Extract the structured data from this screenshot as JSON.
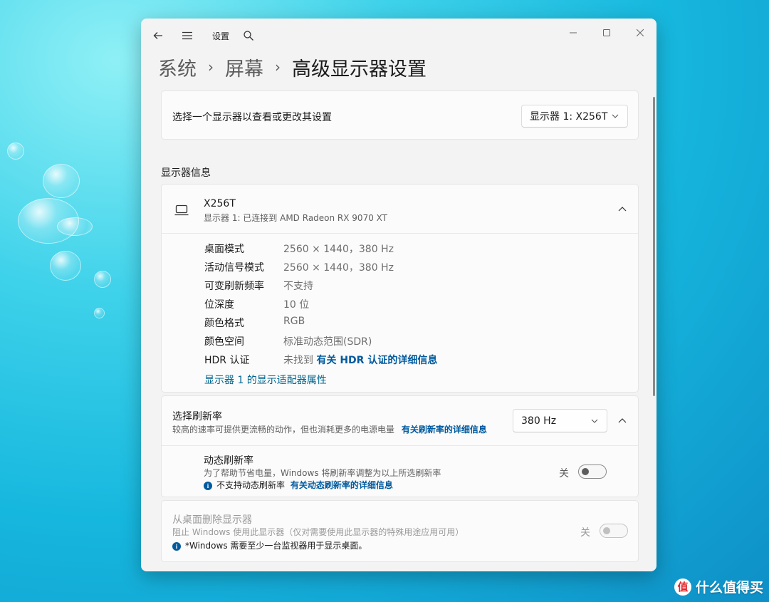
{
  "app": {
    "title": "设置"
  },
  "breadcrumb": {
    "items": [
      "系统",
      "屏幕"
    ],
    "current": "高级显示器设置"
  },
  "select_display": {
    "label": "选择一个显示器以查看或更改其设置",
    "value": "显示器 1: X256T"
  },
  "display_info": {
    "section_title": "显示器信息",
    "monitor_name": "X256T",
    "monitor_desc": "显示器 1: 已连接到 AMD Radeon RX 9070 XT",
    "rows": [
      {
        "label": "桌面模式",
        "value": "2560 × 1440，380 Hz"
      },
      {
        "label": "活动信号模式",
        "value": "2560 × 1440，380 Hz"
      },
      {
        "label": "可变刷新频率",
        "value": "不支持"
      },
      {
        "label": "位深度",
        "value": "10 位"
      },
      {
        "label": "颜色格式",
        "value": "RGB"
      },
      {
        "label": "颜色空间",
        "value": "标准动态范围(SDR)"
      }
    ],
    "hdr_label": "HDR 认证",
    "hdr_value": "未找到",
    "hdr_link": "有关 HDR 认证的详细信息",
    "adapter_link": "显示器 1 的显示适配器属性"
  },
  "refresh_rate": {
    "title": "选择刷新率",
    "desc": "较高的速率可提供更流畅的动作，但也消耗更多的电源电量",
    "link": "有关刷新率的详细信息",
    "value": "380 Hz"
  },
  "dynamic_refresh": {
    "title": "动态刷新率",
    "desc": "为了帮助节省电量，Windows 将刷新率调整为以上所选刷新率",
    "note": "不支持动态刷新率",
    "link": "有关动态刷新率的详细信息",
    "toggle_label": "关",
    "toggle_on": false
  },
  "remove_display": {
    "title": "从桌面删除显示器",
    "desc": "阻止 Windows 使用此显示器（仅对需要使用此显示器的特殊用途应用可用）",
    "note": "*Windows 需要至少一台监视器用于显示桌面。",
    "toggle_label": "关",
    "toggle_on": false,
    "disabled": true
  },
  "watermark": {
    "logo_char": "值",
    "text": "什么值得买"
  }
}
